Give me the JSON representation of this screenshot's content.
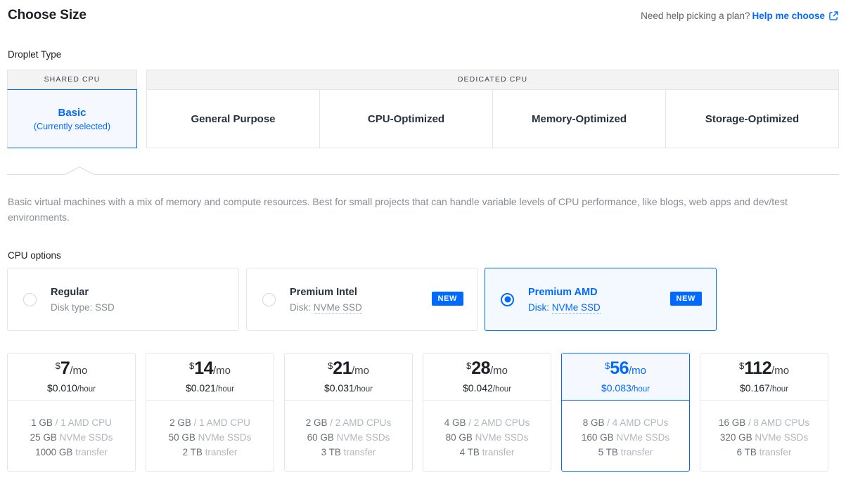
{
  "header": {
    "title": "Choose Size",
    "help_prefix": "Need help picking a plan?",
    "help_link": "Help me choose",
    "external_icon": "external-link-icon"
  },
  "droplet_type": {
    "label": "Droplet Type",
    "groups": [
      {
        "name": "SHARED CPU",
        "tabs": [
          {
            "label": "Basic",
            "sub": "(Currently selected)",
            "selected": true
          }
        ]
      },
      {
        "name": "DEDICATED CPU",
        "tabs": [
          {
            "label": "General Purpose",
            "sub": "",
            "selected": false
          },
          {
            "label": "CPU-Optimized",
            "sub": "",
            "selected": false
          },
          {
            "label": "Memory-Optimized",
            "sub": "",
            "selected": false
          },
          {
            "label": "Storage-Optimized",
            "sub": "",
            "selected": false
          }
        ]
      }
    ]
  },
  "description": "Basic virtual machines with a mix of memory and compute resources. Best for small projects that can handle variable levels of CPU performance, like blogs, web apps and dev/test environments.",
  "cpu_options": {
    "label": "CPU options",
    "badge_new": "NEW",
    "items": [
      {
        "name": "Regular",
        "disk_prefix": "Disk type: ",
        "disk_value": "SSD",
        "disk_dotted": false,
        "badge": null,
        "selected": false
      },
      {
        "name": "Premium Intel",
        "disk_prefix": "Disk: ",
        "disk_value": "NVMe SSD",
        "disk_dotted": true,
        "badge": "NEW",
        "selected": false
      },
      {
        "name": "Premium AMD",
        "disk_prefix": "Disk: ",
        "disk_value": "NVMe SSD",
        "disk_dotted": true,
        "badge": "NEW",
        "selected": true
      }
    ]
  },
  "plans": {
    "currency": "$",
    "per_month": "/mo",
    "per_hour": "/hour",
    "items": [
      {
        "monthly": "7",
        "hourly": "$0.010",
        "selected": false,
        "memory": "1 GB",
        "cpu": "1 AMD CPU",
        "disk": "25 GB",
        "disk_label": "NVMe SSDs",
        "transfer": "1000 GB",
        "transfer_label": "transfer"
      },
      {
        "monthly": "14",
        "hourly": "$0.021",
        "selected": false,
        "memory": "2 GB",
        "cpu": "1 AMD CPU",
        "disk": "50 GB",
        "disk_label": "NVMe SSDs",
        "transfer": "2 TB",
        "transfer_label": "transfer"
      },
      {
        "monthly": "21",
        "hourly": "$0.031",
        "selected": false,
        "memory": "2 GB",
        "cpu": "2 AMD CPUs",
        "disk": "60 GB",
        "disk_label": "NVMe SSDs",
        "transfer": "3 TB",
        "transfer_label": "transfer"
      },
      {
        "monthly": "28",
        "hourly": "$0.042",
        "selected": false,
        "memory": "4 GB",
        "cpu": "2 AMD CPUs",
        "disk": "80 GB",
        "disk_label": "NVMe SSDs",
        "transfer": "4 TB",
        "transfer_label": "transfer"
      },
      {
        "monthly": "56",
        "hourly": "$0.083",
        "selected": true,
        "memory": "8 GB",
        "cpu": "4 AMD CPUs",
        "disk": "160 GB",
        "disk_label": "NVMe SSDs",
        "transfer": "5 TB",
        "transfer_label": "transfer"
      },
      {
        "monthly": "112",
        "hourly": "$0.167",
        "selected": false,
        "memory": "16 GB",
        "cpu": "8 AMD CPUs",
        "disk": "320 GB",
        "disk_label": "NVMe SSDs",
        "transfer": "6 TB",
        "transfer_label": "transfer"
      }
    ]
  },
  "colors": {
    "accent": "#0069ff",
    "accent_bg": "#f5f9ff",
    "border": "#e5e5e5",
    "text": "#1b1f23",
    "muted": "#888d94",
    "muted_light": "#b2b7bd"
  }
}
